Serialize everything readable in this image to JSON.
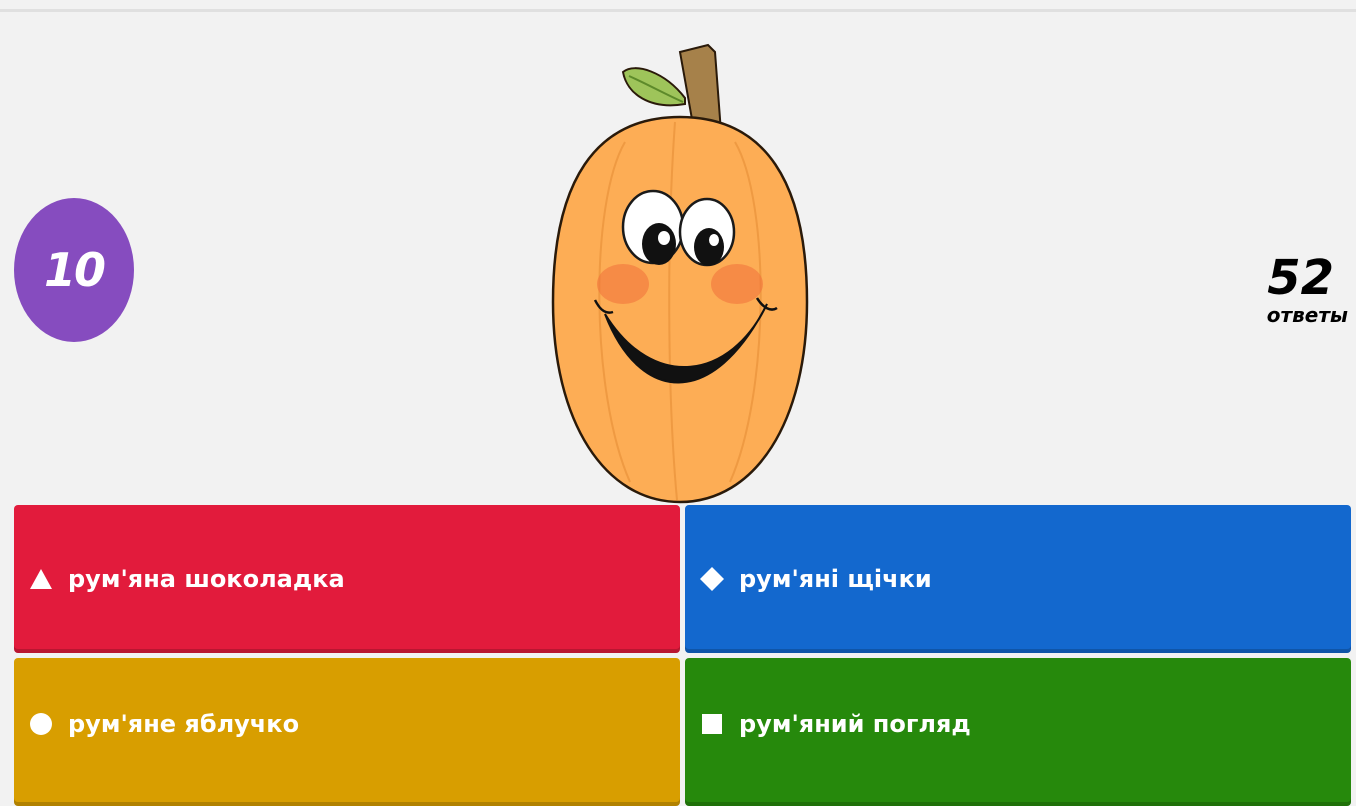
{
  "timer": {
    "value": "10"
  },
  "answers_counter": {
    "count": "52",
    "label": "ответы"
  },
  "question_image": {
    "description_icon": "pumpkin-face-icon"
  },
  "options": [
    {
      "shape": "triangle-icon",
      "text": "рум'яна шоколадка",
      "color": "#e21b3c"
    },
    {
      "shape": "diamond-icon",
      "text": "рум'яні щічки",
      "color": "#1368ce"
    },
    {
      "shape": "circle-icon",
      "text": "рум'яне яблучко",
      "color": "#d89e00"
    },
    {
      "shape": "square-icon",
      "text": "рум'яний погляд",
      "color": "#26890c"
    }
  ]
}
